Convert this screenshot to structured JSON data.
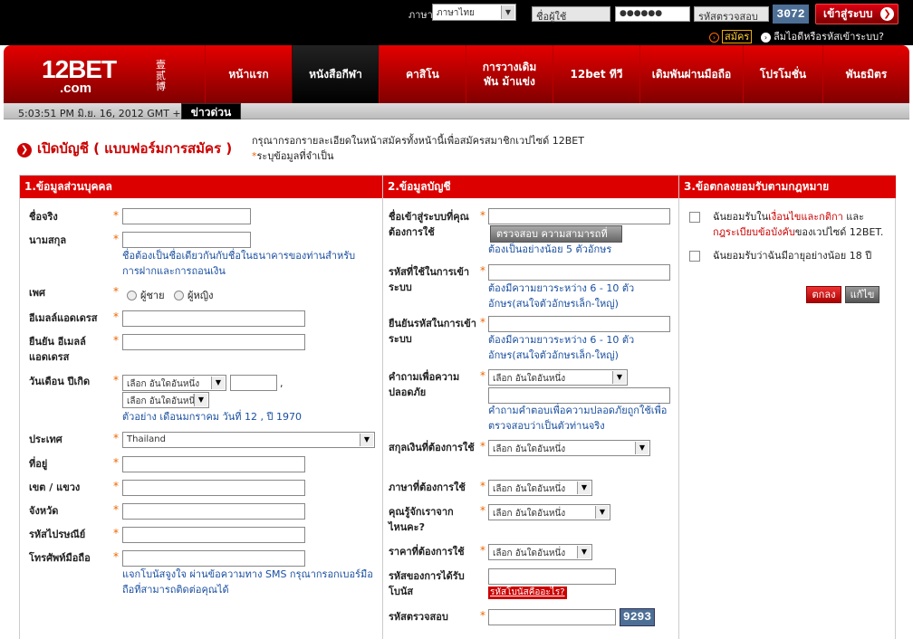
{
  "header": {
    "lang_label": "ภาษา",
    "lang_value": "ภาษาไทย",
    "username_placeholder": "ชื่อผู้ใช้",
    "password_value": "●●●●●●",
    "captcha_placeholder": "รหัสตรวจสอบ",
    "captcha_code": "3072",
    "login_label": "เข้าสู่ระบบ",
    "register_label": "สมัคร",
    "forgot_label": "ลืมไอดีหรือรหัสเข้าระบบ?"
  },
  "logo": {
    "main": "12BET",
    "sub": ".com",
    "cn": "壹贰博"
  },
  "nav": [
    {
      "label": "หน้าแรก"
    },
    {
      "label": "หนังสือกีฬา"
    },
    {
      "label": "คาสิโน"
    },
    {
      "label": "การวางเดิมพัน ม้าแข่ง"
    },
    {
      "label": "12bet ทีวี"
    },
    {
      "label": "เดิมพันผ่านมือถือ"
    },
    {
      "label": "โปรโมชั่น"
    },
    {
      "label": "พันธมิตร"
    }
  ],
  "subbar": {
    "datetime": "5:03:51 PM มิ.ย. 16, 2012 GMT +8",
    "news": "ข่าวด่วน"
  },
  "page": {
    "title": "เปิดบัญชี ( แบบฟอร์มการสมัคร )",
    "intro": "กรุณากรอกรายละเอียดในหน้าสมัครทั้งหน้านี้เพื่อสมัครสมาชิกเวปไซด์ 12BET",
    "required_note": "ระบุข้อมูลที่จำเป็น",
    "star": "*"
  },
  "sections": {
    "personal": "1.ข้อมูลส่วนบุคคล",
    "account": "2.ข้อมูลบัญชี",
    "terms": "3.ข้อตกลงยอมรับตามกฎหมาย"
  },
  "personal": {
    "firstname": "ชื่อจริง",
    "lastname": "นามสกุล",
    "lastname_hint": "ชื่อต้องเป็นชื่อเดียวกันกับชื่อในธนาคารของท่านสำหรับการฝากและการถอนเงิน",
    "gender": "เพศ",
    "male": "ผู้ชาย",
    "female": "ผู้หญิง",
    "email": "อีเมลล์แอดเดรส",
    "email_confirm": "ยืนยัน อีเมลล์แอดเดรส",
    "birthday": "วันเดือน ปีเกิด",
    "select_one": "เลือก อันใดอันหนึ่ง",
    "comma": ",",
    "birthday_hint": "ตัวอย่าง เดือนมกราคม วันที่ 12 , ปี 1970",
    "country": "ประเทศ",
    "country_value": "Thailand",
    "address": "ที่อยู่",
    "district": "เขต / แขวง",
    "province": "จังหวัด",
    "postcode": "รหัสไปรษณีย์",
    "mobile": "โทรศัพท์มือถือ",
    "mobile_hint": "แจกโบนัสจูงใจ ผ่านข้อความทาง SMS กรุณากรอกเบอร์มือถือที่สามารถติดต่อคุณได้"
  },
  "account": {
    "username": "ชื่อเข้าสู่ระบบที่คุณต้องการใช้",
    "check_btn": "ตรวจสอบ ความสามารถที่จะใช้",
    "username_hint": "ต้องเป็นอย่างน้อย 5 ตัวอักษร",
    "password": "รหัสที่ใช้ในการเข้าระบบ",
    "password_hint": "ต้องมีความยาวระหว่าง 6 - 10 ตัวอักษร(สนใจตัวอักษรเล็ก-ใหญ่)",
    "password_confirm": "ยืนยันรหัสในการเข้าระบบ",
    "password_confirm_hint": "ต้องมีความยาวระหว่าง 6 - 10 ตัวอักษร(สนใจตัวอักษรเล็ก-ใหญ่)",
    "security_q": "คำถามเพื่อความปลอดภัย",
    "security_hint": "คำถามคำตอบเพื่อความปลอดภัยถูกใช้เพื่อตรวจสอบว่าเป็นตัวท่านจริง",
    "currency": "สกุลเงินที่ต้องการใช้",
    "language": "ภาษาที่ต้องการใช้",
    "how_know": "คุณรู้จักเราจากไหนคะ?",
    "odds": "ราคาที่ต้องการใช้",
    "bonus_code": "รหัสของการได้รับโบนัส",
    "bonus_link": "รหัสโบนัสคืออะไร?",
    "captcha": "รหัสตรวจสอบ",
    "captcha_code": "9293"
  },
  "terms": {
    "t1_pre": "ฉันยอมรับใน",
    "t1_link1": "เงื่อนไขและกติกา",
    "t1_mid": " และ",
    "t1_link2": "กฎระเบียบข้อบังคับ",
    "t1_post": "ของเวปไซด์ 12BET.",
    "t2": "ฉันยอมรับว่าฉันมีอายุอย่างน้อย 18 ปี",
    "agree": "ตกลง",
    "edit": "แก้ไข"
  }
}
